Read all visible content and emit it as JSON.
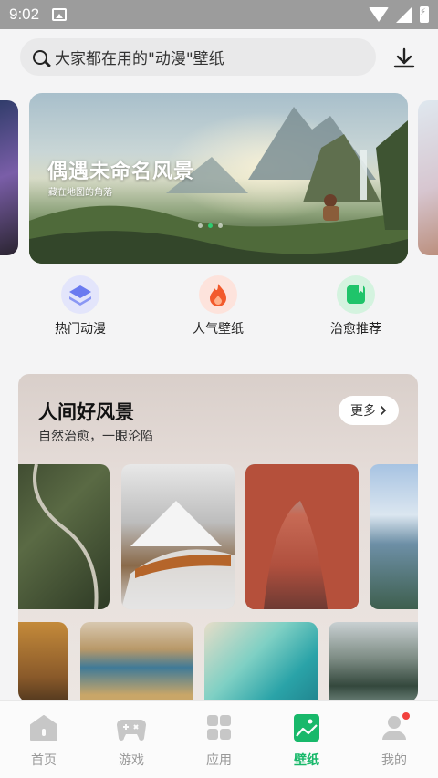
{
  "status_bar": {
    "time": "9:02"
  },
  "search": {
    "placeholder": "大家都在用的\"动漫\"壁纸"
  },
  "banner": {
    "title": "偶遇未命名风景",
    "subtitle": "藏在地图的角落",
    "page_count": 3,
    "active_index": 1
  },
  "categories": [
    {
      "label": "热门动漫",
      "icon": "layers-icon",
      "color": "#6b7bf0"
    },
    {
      "label": "人气壁纸",
      "icon": "flame-icon",
      "color": "#f25a2c"
    },
    {
      "label": "治愈推荐",
      "icon": "bookmark-icon",
      "color": "#1fc46a"
    }
  ],
  "section": {
    "title": "人间好风景",
    "subtitle": "自然治愈，一眼沦陷",
    "more_label": "更多"
  },
  "nav": [
    {
      "label": "首页",
      "icon": "home-icon"
    },
    {
      "label": "游戏",
      "icon": "gamepad-icon"
    },
    {
      "label": "应用",
      "icon": "apps-grid-icon"
    },
    {
      "label": "壁纸",
      "icon": "wallpaper-icon",
      "active": true
    },
    {
      "label": "我的",
      "icon": "profile-icon",
      "badge": true
    }
  ],
  "colors": {
    "accent": "#18b86a",
    "badge": "#f2413d"
  }
}
